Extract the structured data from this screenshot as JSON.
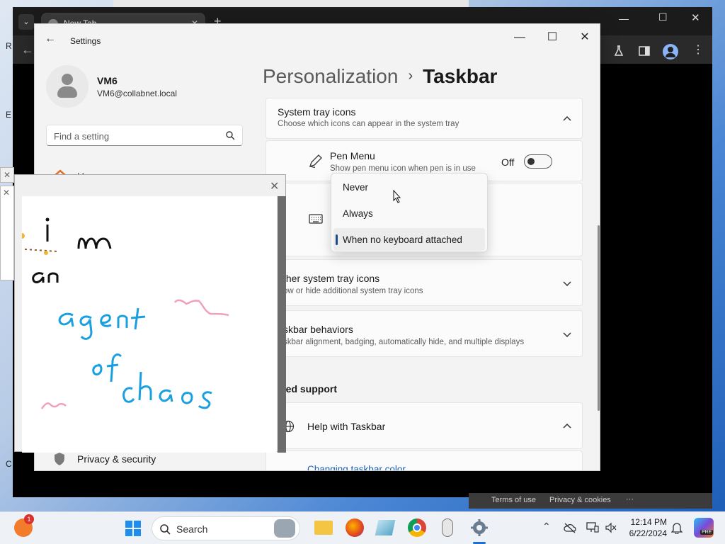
{
  "browser": {
    "tab_title": "New Tab",
    "tab_close": "✕",
    "new_tab": "+",
    "footer_links": [
      "Terms of use",
      "Privacy & cookies",
      "···"
    ],
    "left_edge_letters": [
      "R",
      "E",
      "C"
    ]
  },
  "settings": {
    "app_title": "Settings",
    "back_icon": "←",
    "window_controls": {
      "minimize": "—",
      "maximize": "☐",
      "close": "✕"
    },
    "user": {
      "name": "VM6",
      "email": "VM6@collabnet.local"
    },
    "search": {
      "placeholder": "Find a setting"
    },
    "nav": {
      "home": "Home",
      "privacy": "Privacy & security"
    },
    "breadcrumb": {
      "parent": "Personalization",
      "separator": "›",
      "current": "Taskbar"
    },
    "system_tray": {
      "title": "System tray icons",
      "subtitle": "Choose which icons can appear in the system tray",
      "pen_menu": {
        "title": "Pen Menu",
        "subtitle": "Show pen menu icon when pen is in use",
        "toggle_state": "Off"
      }
    },
    "touch_keyboard_dropdown": {
      "options": [
        "Never",
        "Always",
        "When no keyboard attached"
      ],
      "selected": "When no keyboard attached"
    },
    "other_tray": {
      "title": "ther system tray icons",
      "subtitle": "ow or hide additional system tray icons"
    },
    "behaviors": {
      "title": "skbar behaviors",
      "subtitle": "skbar alignment, badging, automatically hide, and multiple displays"
    },
    "related_support": {
      "heading": "ted support",
      "help_title": "Help with Taskbar",
      "link": "Changing taskbar color"
    }
  },
  "paint": {
    "close": "✕",
    "drawing_text": [
      "i m",
      "an",
      "agent",
      "of",
      "chaos"
    ]
  },
  "taskbar": {
    "search_label": "Search",
    "notification_badge": "1",
    "time": "12:14 PM",
    "date": "6/22/2024",
    "copilot_badge": "PRE"
  },
  "colors": {
    "accent": "#1e4a8a",
    "ink_black": "#111111",
    "ink_blue": "#1aa0e0",
    "ink_pink": "#f2a0b8"
  }
}
